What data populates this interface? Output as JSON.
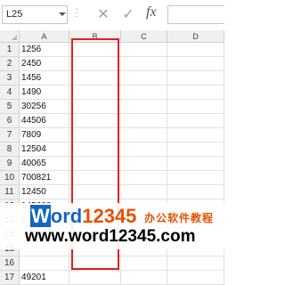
{
  "formula_bar": {
    "name_box": "L25",
    "cancel_icon": "close-icon",
    "enter_icon": "check-icon",
    "fx_label": "fx",
    "formula": ""
  },
  "columns": [
    "A",
    "B",
    "C",
    "D"
  ],
  "rows": [
    {
      "num": "1",
      "a": "1256"
    },
    {
      "num": "2",
      "a": "2450"
    },
    {
      "num": "3",
      "a": "1456"
    },
    {
      "num": "4",
      "a": "1490"
    },
    {
      "num": "5",
      "a": "30256"
    },
    {
      "num": "6",
      "a": "44506"
    },
    {
      "num": "7",
      "a": "7809"
    },
    {
      "num": "8",
      "a": "12504"
    },
    {
      "num": "9",
      "a": "40065"
    },
    {
      "num": "10",
      "a": "700821"
    },
    {
      "num": "11",
      "a": "12450"
    },
    {
      "num": "12",
      "a": "145603"
    },
    {
      "num": "13",
      "a": "148152"
    },
    {
      "num": "14",
      "a": ""
    },
    {
      "num": "15",
      "a": ""
    },
    {
      "num": "16",
      "a": ""
    },
    {
      "num": "17",
      "a": "49201"
    }
  ],
  "watermark": {
    "logo_w": "W",
    "logo_rest": "ord",
    "logo_num": "12345",
    "tagline": "办公软件教程",
    "url": "www.word12345.com"
  },
  "colors": {
    "selection": "#e02020",
    "watermark_blue": "#1565c0",
    "watermark_orange": "#e65100"
  }
}
